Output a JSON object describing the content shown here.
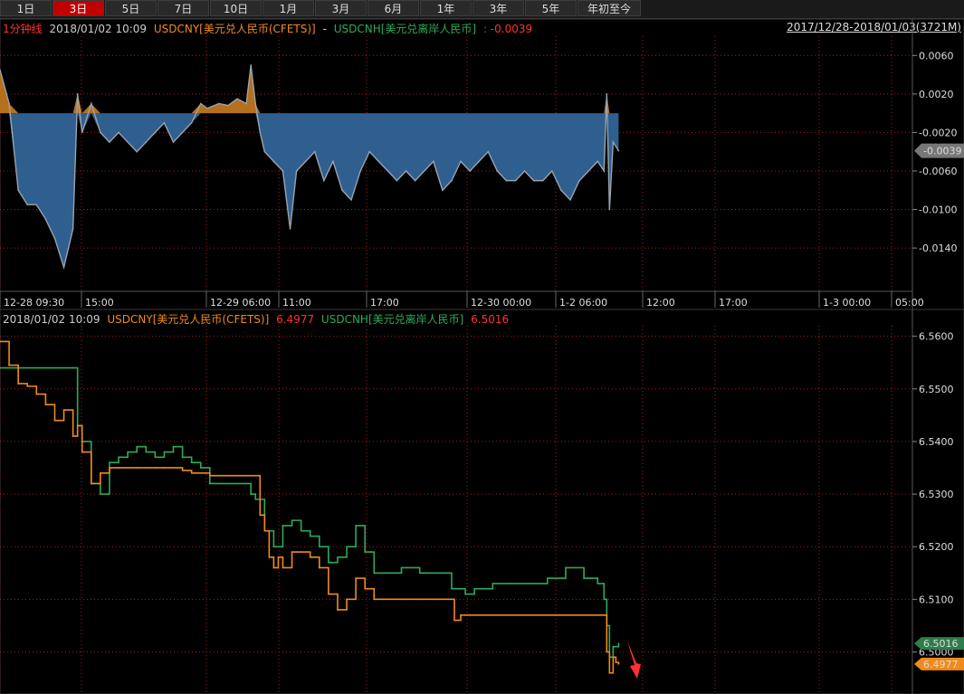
{
  "tabs": [
    "1日",
    "3日",
    "5日",
    "7日",
    "10日",
    "1月",
    "3月",
    "6月",
    "1年",
    "3年",
    "5年",
    "年初至今"
  ],
  "active_tab": 1,
  "top_panel": {
    "interval": "1分钟线",
    "datetime": "2018/01/02 10:09",
    "series1": "USDCNY[美元兑人民币(CFETS)]",
    "sep": "-",
    "series2": "USDCNH[美元兑离岸人民币]",
    "value": ": -0.0039",
    "range": "2017/12/28-2018/01/03(3721M)"
  },
  "bottom_panel": {
    "datetime": "2018/01/02 10:09",
    "series1": "USDCNY[美元兑人民币(CFETS)]",
    "value1": "6.4977",
    "series2": "USDCNH[美元兑离岸人民币]",
    "value2": "6.5016"
  },
  "x_ticks": [
    "12-28 09:30",
    "15:00",
    "12-29 06:00",
    "11:00",
    "17:00",
    "12-30 00:00",
    "1-2 06:00",
    "12:00",
    "17:00",
    "1-3 00:00",
    "05:00"
  ],
  "colors": {
    "cny": "#f08a1c",
    "cnh": "#2eaa5a",
    "spread_fill": "#2f5f8f",
    "spread_pos": "#b4701c",
    "spread_line": "#9aa3ad",
    "grid": "#a02020",
    "red": "#ff3030"
  },
  "chart_data": [
    {
      "type": "area",
      "title": "USDCNY[美元兑人民币(CFETS)] - USDCNH[美元兑离岸人民币]",
      "ylim": [
        -0.0185,
        0.008
      ],
      "yticks": [
        "0.0060",
        "0.0020",
        "-0.0020",
        "-0.0060",
        "-0.0100",
        "-0.0140"
      ],
      "last_label": "-0.0039",
      "series": [
        {
          "x": [
            0,
            10,
            20,
            30,
            40,
            50,
            60,
            70,
            80,
            85,
            90,
            100,
            110,
            120,
            130,
            140,
            150,
            160,
            170,
            180,
            190,
            200,
            210,
            220,
            227,
            240,
            250,
            260,
            270,
            275,
            280,
            285,
            290,
            300,
            310,
            318,
            325,
            335,
            345,
            355,
            365,
            375,
            385,
            395,
            405,
            415,
            425,
            435,
            445,
            455,
            465,
            475,
            485,
            495,
            505,
            515,
            525,
            535,
            545,
            555,
            565,
            575,
            585,
            595,
            605,
            615,
            625,
            635,
            645,
            655,
            662,
            665,
            668,
            672,
            678
          ],
          "values": [
            0.0045,
            0.001,
            -0.008,
            -0.0095,
            -0.0095,
            -0.011,
            -0.013,
            -0.016,
            -0.012,
            0.002,
            -0.002,
            0.001,
            -0.002,
            -0.003,
            -0.002,
            -0.003,
            -0.004,
            -0.003,
            -0.002,
            -0.001,
            -0.003,
            -0.002,
            -0.001,
            0.001,
            0.0005,
            0.001,
            0.0008,
            0.0015,
            0.001,
            0.005,
            0.001,
            -0.002,
            -0.004,
            -0.005,
            -0.006,
            -0.012,
            -0.006,
            -0.005,
            -0.004,
            -0.007,
            -0.005,
            -0.008,
            -0.009,
            -0.006,
            -0.004,
            -0.005,
            -0.006,
            -0.007,
            -0.006,
            -0.007,
            -0.006,
            -0.005,
            -0.008,
            -0.007,
            -0.005,
            -0.006,
            -0.005,
            -0.004,
            -0.006,
            -0.007,
            -0.007,
            -0.006,
            -0.007,
            -0.007,
            -0.006,
            -0.008,
            -0.009,
            -0.007,
            -0.006,
            -0.005,
            -0.006,
            0.002,
            -0.01,
            -0.003,
            -0.0039
          ]
        }
      ]
    },
    {
      "type": "line",
      "title": "USDCNY / USDCNH",
      "ylim": [
        6.492,
        6.562
      ],
      "yticks": [
        "6.5600",
        "6.5500",
        "6.5400",
        "6.5300",
        "6.5200",
        "6.5100",
        "6.5000"
      ],
      "series": [
        {
          "name": "USDCNY[美元兑人民币(CFETS)]",
          "last": "6.4977",
          "x": [
            0,
            10,
            20,
            30,
            40,
            50,
            60,
            70,
            80,
            85,
            90,
            100,
            110,
            120,
            130,
            140,
            150,
            160,
            170,
            180,
            190,
            200,
            210,
            220,
            230,
            240,
            250,
            260,
            270,
            280,
            285,
            290,
            295,
            300,
            305,
            310,
            320,
            330,
            340,
            350,
            360,
            370,
            380,
            390,
            400,
            410,
            420,
            440,
            460,
            480,
            495,
            498,
            502,
            505,
            510,
            520,
            540,
            560,
            580,
            600,
            620,
            640,
            660,
            665,
            668,
            672,
            675,
            678
          ],
          "values": [
            6.559,
            6.5545,
            6.551,
            6.5505,
            6.549,
            6.547,
            6.544,
            6.546,
            6.541,
            6.543,
            6.538,
            6.532,
            6.534,
            6.535,
            6.535,
            6.535,
            6.535,
            6.535,
            6.535,
            6.535,
            6.535,
            6.5345,
            6.534,
            6.534,
            6.5335,
            6.5335,
            6.5335,
            6.5335,
            6.5335,
            6.5335,
            6.526,
            6.523,
            6.518,
            6.516,
            6.518,
            6.516,
            6.519,
            6.519,
            6.518,
            6.516,
            6.511,
            6.508,
            6.51,
            6.514,
            6.512,
            6.51,
            6.51,
            6.51,
            6.51,
            6.51,
            6.51,
            6.506,
            6.506,
            6.507,
            6.507,
            6.507,
            6.507,
            6.507,
            6.507,
            6.507,
            6.507,
            6.507,
            6.507,
            6.5,
            6.496,
            6.499,
            6.498,
            6.4977
          ]
        },
        {
          "name": "USDCNH[美元兑离岸人民币]",
          "last": "6.5016",
          "x": [
            0,
            20,
            40,
            60,
            80,
            85,
            90,
            100,
            110,
            120,
            130,
            140,
            150,
            160,
            170,
            180,
            190,
            200,
            210,
            220,
            230,
            240,
            250,
            260,
            270,
            275,
            280,
            290,
            300,
            310,
            320,
            330,
            340,
            350,
            360,
            370,
            380,
            390,
            400,
            410,
            420,
            440,
            460,
            480,
            495,
            510,
            520,
            540,
            560,
            580,
            600,
            620,
            640,
            655,
            662,
            665,
            668,
            672,
            678
          ],
          "values": [
            6.554,
            6.554,
            6.554,
            6.554,
            6.554,
            6.543,
            6.54,
            6.532,
            6.53,
            6.536,
            6.537,
            6.538,
            6.539,
            6.538,
            6.537,
            6.538,
            6.539,
            6.537,
            6.536,
            6.535,
            6.532,
            6.532,
            6.532,
            6.532,
            6.532,
            6.53,
            6.529,
            6.523,
            6.52,
            6.524,
            6.525,
            6.523,
            6.522,
            6.52,
            6.517,
            6.518,
            6.52,
            6.524,
            6.519,
            6.515,
            6.515,
            6.516,
            6.515,
            6.515,
            6.512,
            6.511,
            6.512,
            6.513,
            6.513,
            6.513,
            6.514,
            6.516,
            6.514,
            6.513,
            6.51,
            6.505,
            6.499,
            6.501,
            6.5016
          ]
        }
      ]
    }
  ]
}
